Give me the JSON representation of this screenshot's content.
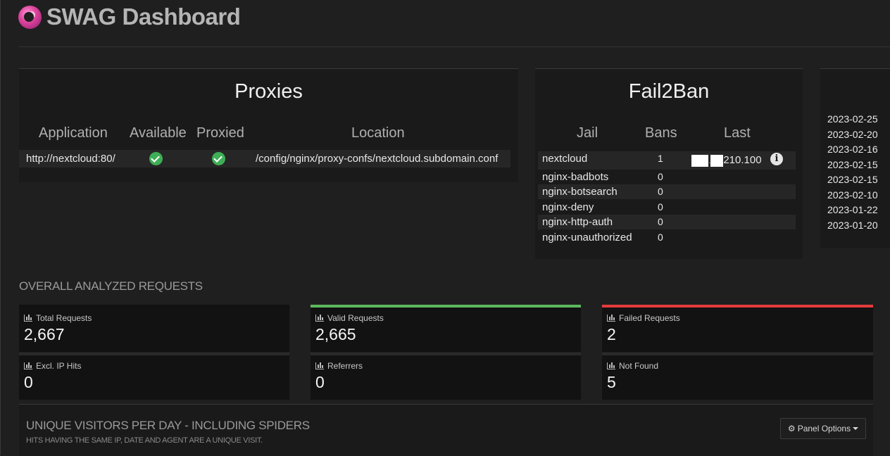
{
  "app": {
    "title": "SWAG Dashboard",
    "logo_icon": "swag-logo-icon"
  },
  "proxies": {
    "title": "Proxies",
    "columns": [
      "Application",
      "Available",
      "Proxied",
      "Location"
    ],
    "rows": [
      {
        "application": "http://nextcloud:80/",
        "available": true,
        "proxied": true,
        "location": "/config/nginx/proxy-confs/nextcloud.subdomain.conf"
      }
    ]
  },
  "fail2ban": {
    "title": "Fail2Ban",
    "columns": [
      "Jail",
      "Bans",
      "Last"
    ],
    "rows": [
      {
        "jail": "nextcloud",
        "bans": "1",
        "last": "210.100"
      },
      {
        "jail": "nginx-badbots",
        "bans": "0",
        "last": ""
      },
      {
        "jail": "nginx-botsearch",
        "bans": "0",
        "last": ""
      },
      {
        "jail": "nginx-deny",
        "bans": "0",
        "last": ""
      },
      {
        "jail": "nginx-http-auth",
        "bans": "0",
        "last": ""
      },
      {
        "jail": "nginx-unauthorized",
        "bans": "0",
        "last": ""
      }
    ]
  },
  "updates": {
    "dates": [
      "2023-02-25",
      "2023-02-20",
      "2023-02-16",
      "2023-02-15",
      "2023-02-15",
      "2023-02-10",
      "2023-01-22",
      "2023-01-20"
    ]
  },
  "overall": {
    "title": "OVERALL ANALYZED REQUESTS",
    "stats": [
      {
        "label": "Total Requests",
        "value": "2,667",
        "accent": "#111111"
      },
      {
        "label": "Valid Requests",
        "value": "2,665",
        "accent": "#5cb85c"
      },
      {
        "label": "Failed Requests",
        "value": "2",
        "accent": "#e33b3b"
      },
      {
        "label": "Excl. IP Hits",
        "value": "0"
      },
      {
        "label": "Referrers",
        "value": "0"
      },
      {
        "label": "Not Found",
        "value": "5"
      }
    ]
  },
  "visitors": {
    "title": "UNIQUE VISITORS PER DAY - INCLUDING SPIDERS",
    "subtitle": "HITS HAVING THE SAME IP, DATE AND AGENT ARE A UNIQUE VISIT.",
    "panel_options_label": "Panel Options"
  }
}
